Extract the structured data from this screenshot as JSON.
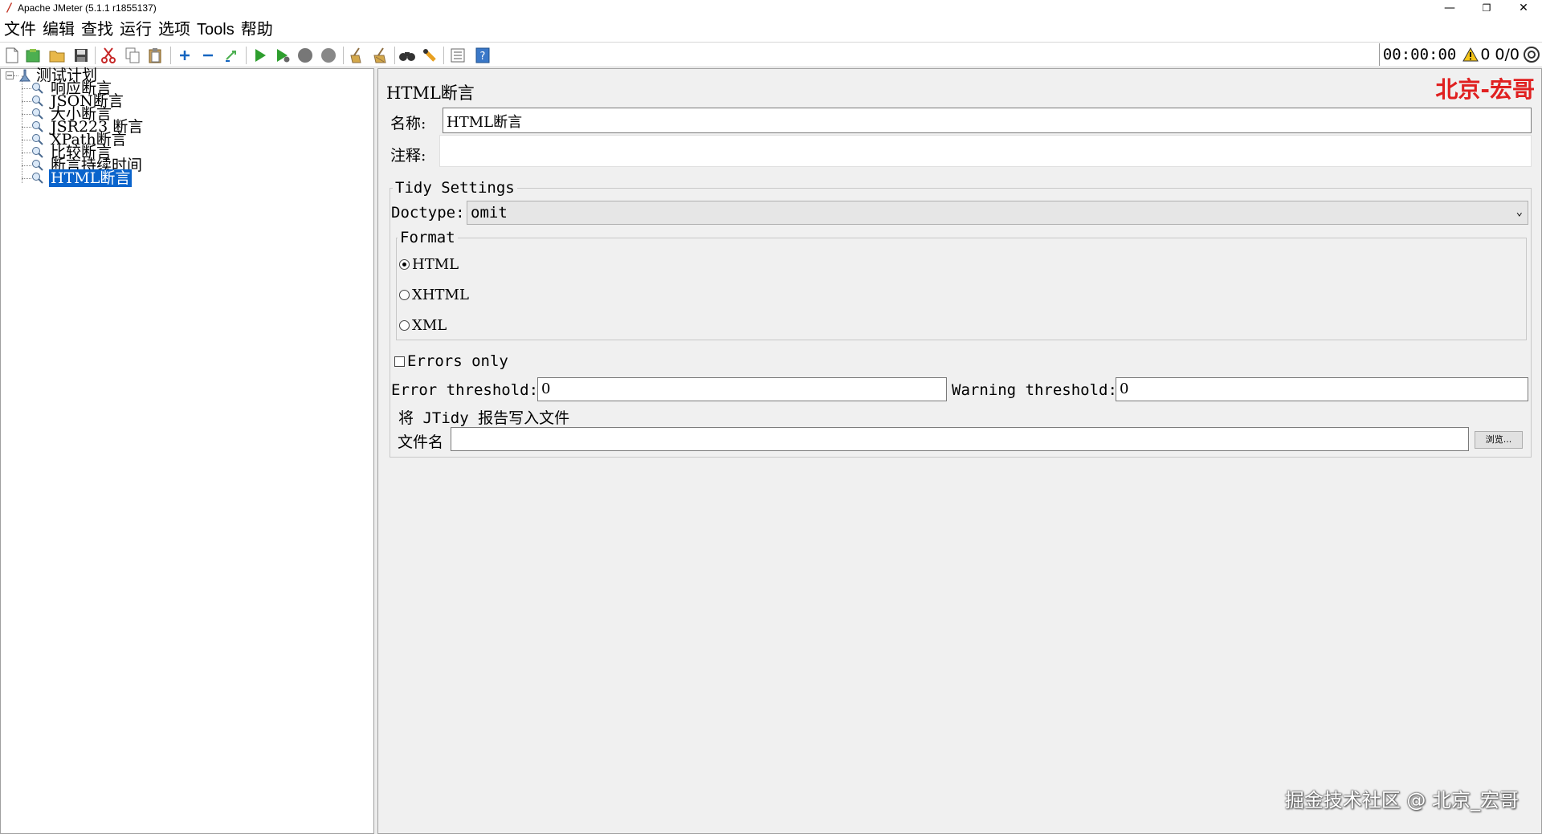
{
  "window": {
    "title": "Apache JMeter (5.1.1 r1855137)",
    "minimize": "—",
    "restore": "❐",
    "close": "✕"
  },
  "menu": [
    "文件",
    "编辑",
    "查找",
    "运行",
    "选项",
    "Tools",
    "帮助"
  ],
  "toolbar": {
    "icons": [
      "new-icon",
      "templates-icon",
      "open-icon",
      "save-icon",
      "cut-icon",
      "copy-icon",
      "paste-icon",
      "expand-icon",
      "collapse-icon",
      "toggle-icon",
      "start-icon",
      "start-no-pause-icon",
      "stop-icon",
      "shutdown-icon",
      "clear-icon",
      "clear-all-icon",
      "search-icon",
      "reset-search-icon",
      "function-helper-icon",
      "help-icon"
    ],
    "timer": "00:00:00",
    "warning_count": "0",
    "thread_count": "0/0"
  },
  "tree": {
    "root": "测试计划",
    "items": [
      "响应断言",
      "JSON断言",
      "大小断言",
      "JSR223 断言",
      "XPath断言",
      "比较断言",
      "断言持续时间",
      "HTML断言"
    ],
    "selected_index": 7
  },
  "panel": {
    "title": "HTML断言",
    "watermark": "北京-宏哥",
    "name_label": "名称:",
    "name_value": "HTML断言",
    "comment_label": "注释:",
    "comment_value": "",
    "tidy_settings": "Tidy Settings",
    "doctype_label": "Doctype:",
    "doctype_value": "omit",
    "format_label": "Format",
    "formats": [
      "HTML",
      "XHTML",
      "XML"
    ],
    "format_selected": 0,
    "errors_only_label": "Errors only",
    "errors_only_checked": false,
    "error_threshold_label": "Error threshold:",
    "error_threshold_value": "0",
    "warning_threshold_label": "Warning threshold:",
    "warning_threshold_value": "0",
    "write_report_label": "将 JTidy 报告写入文件",
    "filename_label": "文件名",
    "filename_value": "",
    "browse_label": "浏览..."
  },
  "watermark_bottom": "掘金技术社区 @ 北京_宏哥"
}
